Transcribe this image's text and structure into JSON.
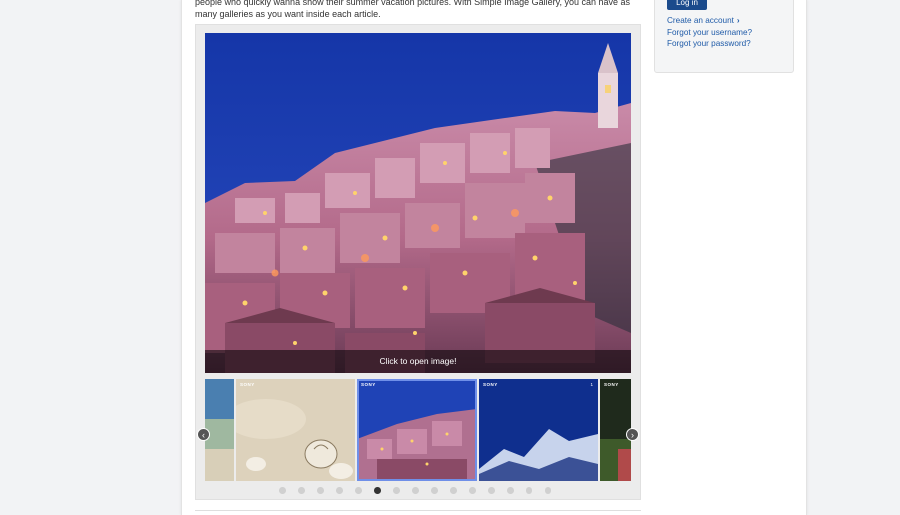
{
  "article": {
    "intro_text": "people who quickly wanna show their summer vacation pictures. With Simple Image Gallery, you can have as many galleries as you want inside each article."
  },
  "gallery": {
    "caption": "Click to open image!",
    "prev_arrow": "‹",
    "next_arrow": "›",
    "thumbnails": [
      {
        "brand": "",
        "num": ""
      },
      {
        "brand": "SONY",
        "num": ""
      },
      {
        "brand": "SONY",
        "num": ""
      },
      {
        "brand": "SONY",
        "num": "1"
      },
      {
        "brand": "SONY",
        "num": ""
      }
    ],
    "dot_count": 15,
    "active_dot_index": 5
  },
  "login": {
    "button_label": "Log in",
    "create_account": "Create an account",
    "forgot_username": "Forgot your username?",
    "forgot_password": "Forgot your password?"
  },
  "icons": {
    "prev": "chevron-left-icon",
    "next": "chevron-right-icon",
    "create_account": "chevron-right-icon"
  }
}
